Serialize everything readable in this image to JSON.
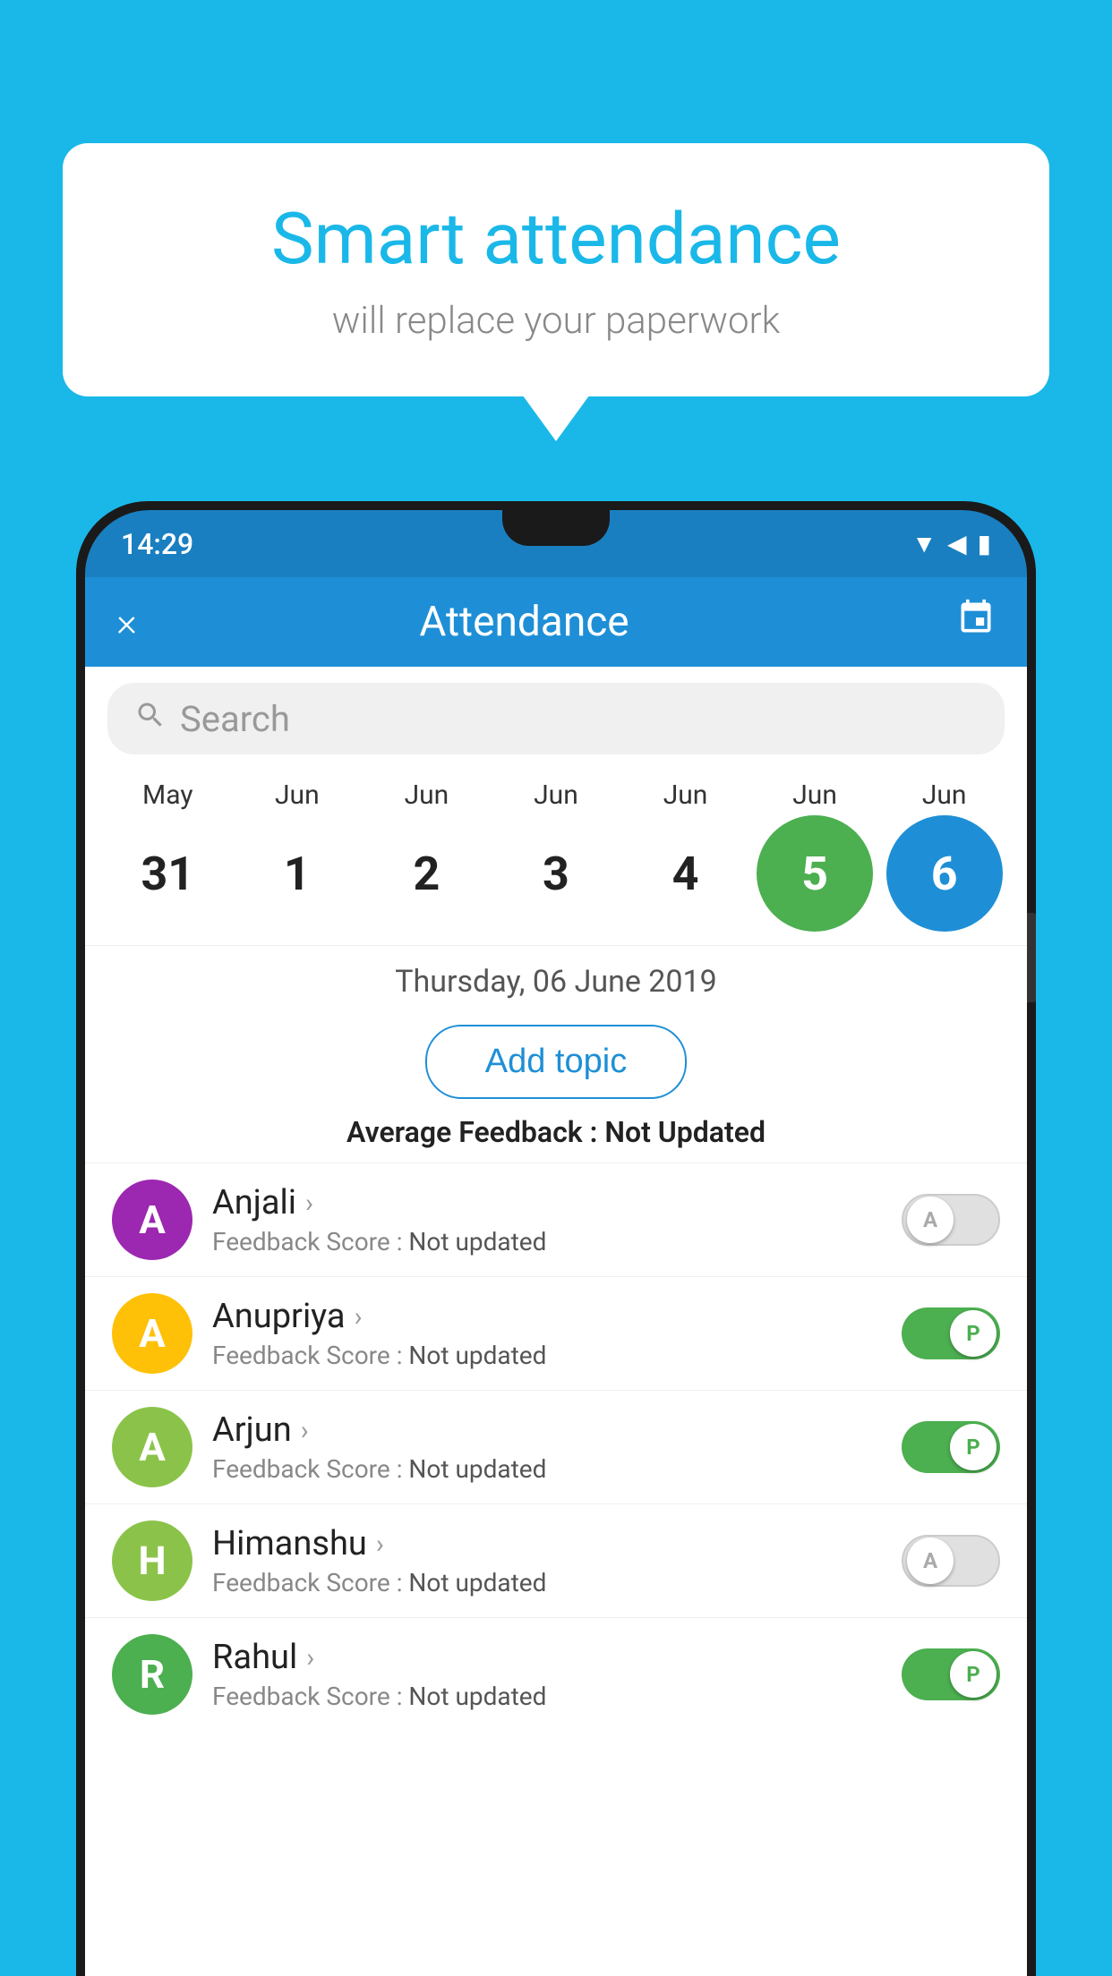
{
  "background_color": "#1ab8e8",
  "bubble": {
    "title": "Smart attendance",
    "subtitle": "will replace your paperwork"
  },
  "status_bar": {
    "time": "14:29"
  },
  "header": {
    "title": "Attendance",
    "close_label": "×",
    "calendar_icon": "📅"
  },
  "search": {
    "placeholder": "Search"
  },
  "calendar": {
    "days": [
      {
        "month": "May",
        "date": "31",
        "state": "normal"
      },
      {
        "month": "Jun",
        "date": "1",
        "state": "normal"
      },
      {
        "month": "Jun",
        "date": "2",
        "state": "normal"
      },
      {
        "month": "Jun",
        "date": "3",
        "state": "normal"
      },
      {
        "month": "Jun",
        "date": "4",
        "state": "normal"
      },
      {
        "month": "Jun",
        "date": "5",
        "state": "today"
      },
      {
        "month": "Jun",
        "date": "6",
        "state": "selected"
      }
    ],
    "selected_date": "Thursday, 06 June 2019"
  },
  "add_topic_label": "Add topic",
  "average_feedback": {
    "label": "Average Feedback : ",
    "value": "Not Updated"
  },
  "students": [
    {
      "name": "Anjali",
      "initial": "A",
      "avatar_color": "#9c27b0",
      "feedback_label": "Feedback Score : ",
      "feedback_value": "Not updated",
      "toggle": "off",
      "toggle_letter": "A"
    },
    {
      "name": "Anupriya",
      "initial": "A",
      "avatar_color": "#ffc107",
      "feedback_label": "Feedback Score : ",
      "feedback_value": "Not updated",
      "toggle": "on",
      "toggle_letter": "P"
    },
    {
      "name": "Arjun",
      "initial": "A",
      "avatar_color": "#8bc34a",
      "feedback_label": "Feedback Score : ",
      "feedback_value": "Not updated",
      "toggle": "on",
      "toggle_letter": "P"
    },
    {
      "name": "Himanshu",
      "initial": "H",
      "avatar_color": "#8bc34a",
      "feedback_label": "Feedback Score : ",
      "feedback_value": "Not updated",
      "toggle": "off",
      "toggle_letter": "A"
    },
    {
      "name": "Rahul",
      "initial": "R",
      "avatar_color": "#4caf50",
      "feedback_label": "Feedback Score : ",
      "feedback_value": "Not updated",
      "toggle": "on",
      "toggle_letter": "P"
    }
  ]
}
